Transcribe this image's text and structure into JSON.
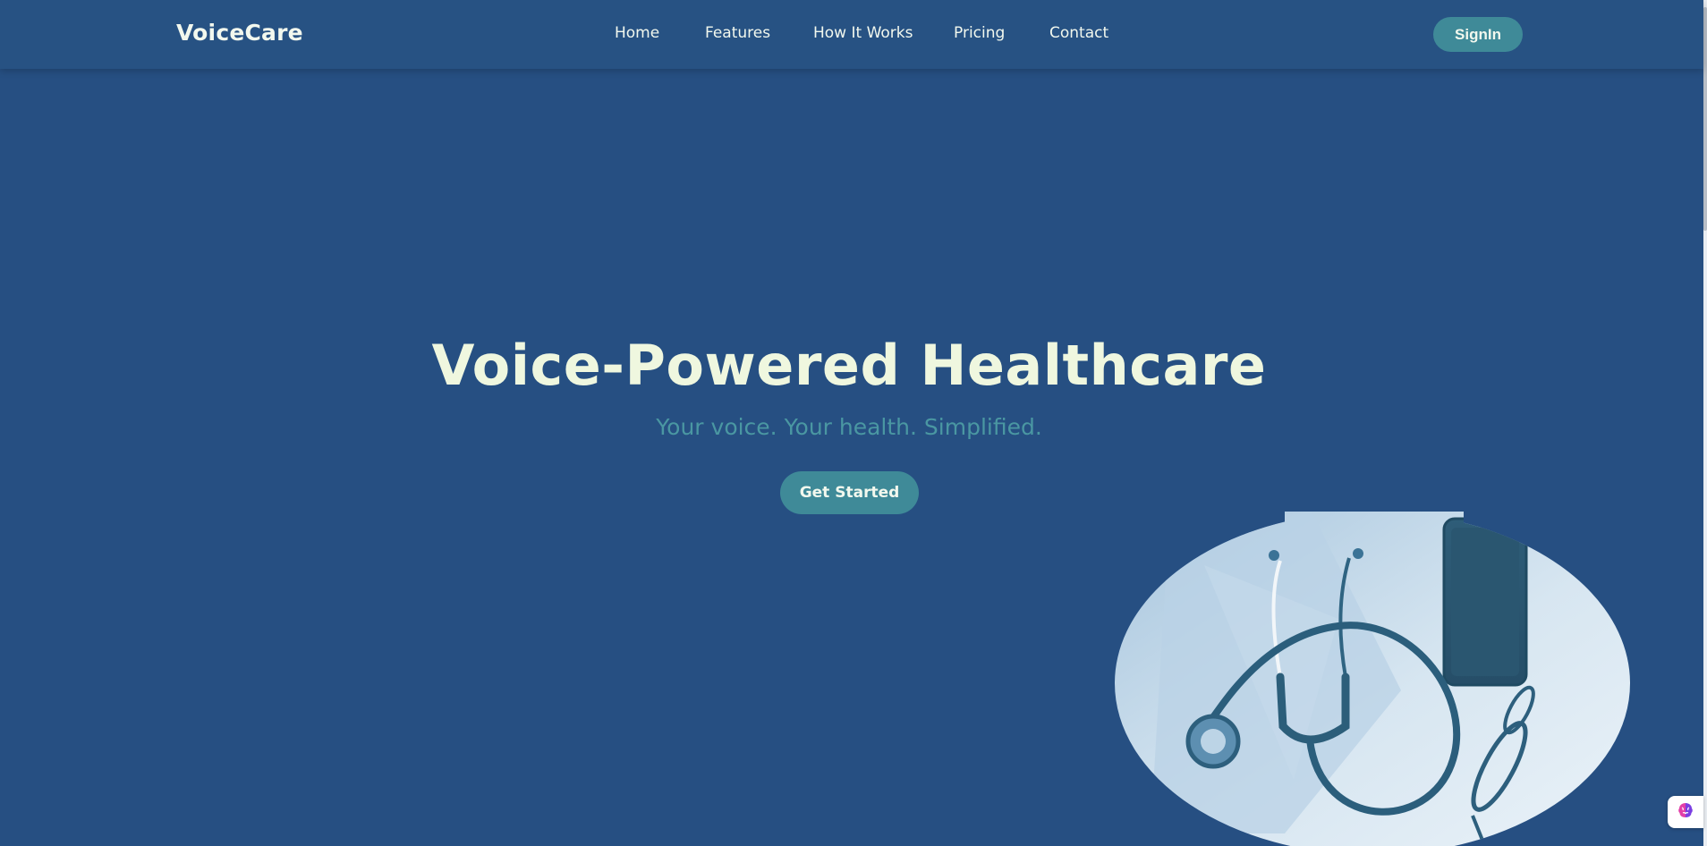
{
  "header": {
    "logo": "VoiceCare",
    "nav": [
      {
        "label": "Home"
      },
      {
        "label": "Features"
      },
      {
        "label": "How It Works"
      },
      {
        "label": "Pricing"
      },
      {
        "label": "Contact"
      }
    ],
    "signin_label": "SignIn"
  },
  "hero": {
    "title": "Voice-Powered Healthcare",
    "subtitle": "Your voice. Your health. Simplified.",
    "cta_label": "Get Started",
    "image_subject": "stethoscope, smartphone and eyeglasses"
  },
  "floating": {
    "icon": "brain-icon"
  },
  "colors": {
    "background": "#264f82",
    "navbar": "#275283",
    "accent": "#3f8a98",
    "title_text": "#eff7df",
    "subtitle_text": "#4a97a2"
  }
}
